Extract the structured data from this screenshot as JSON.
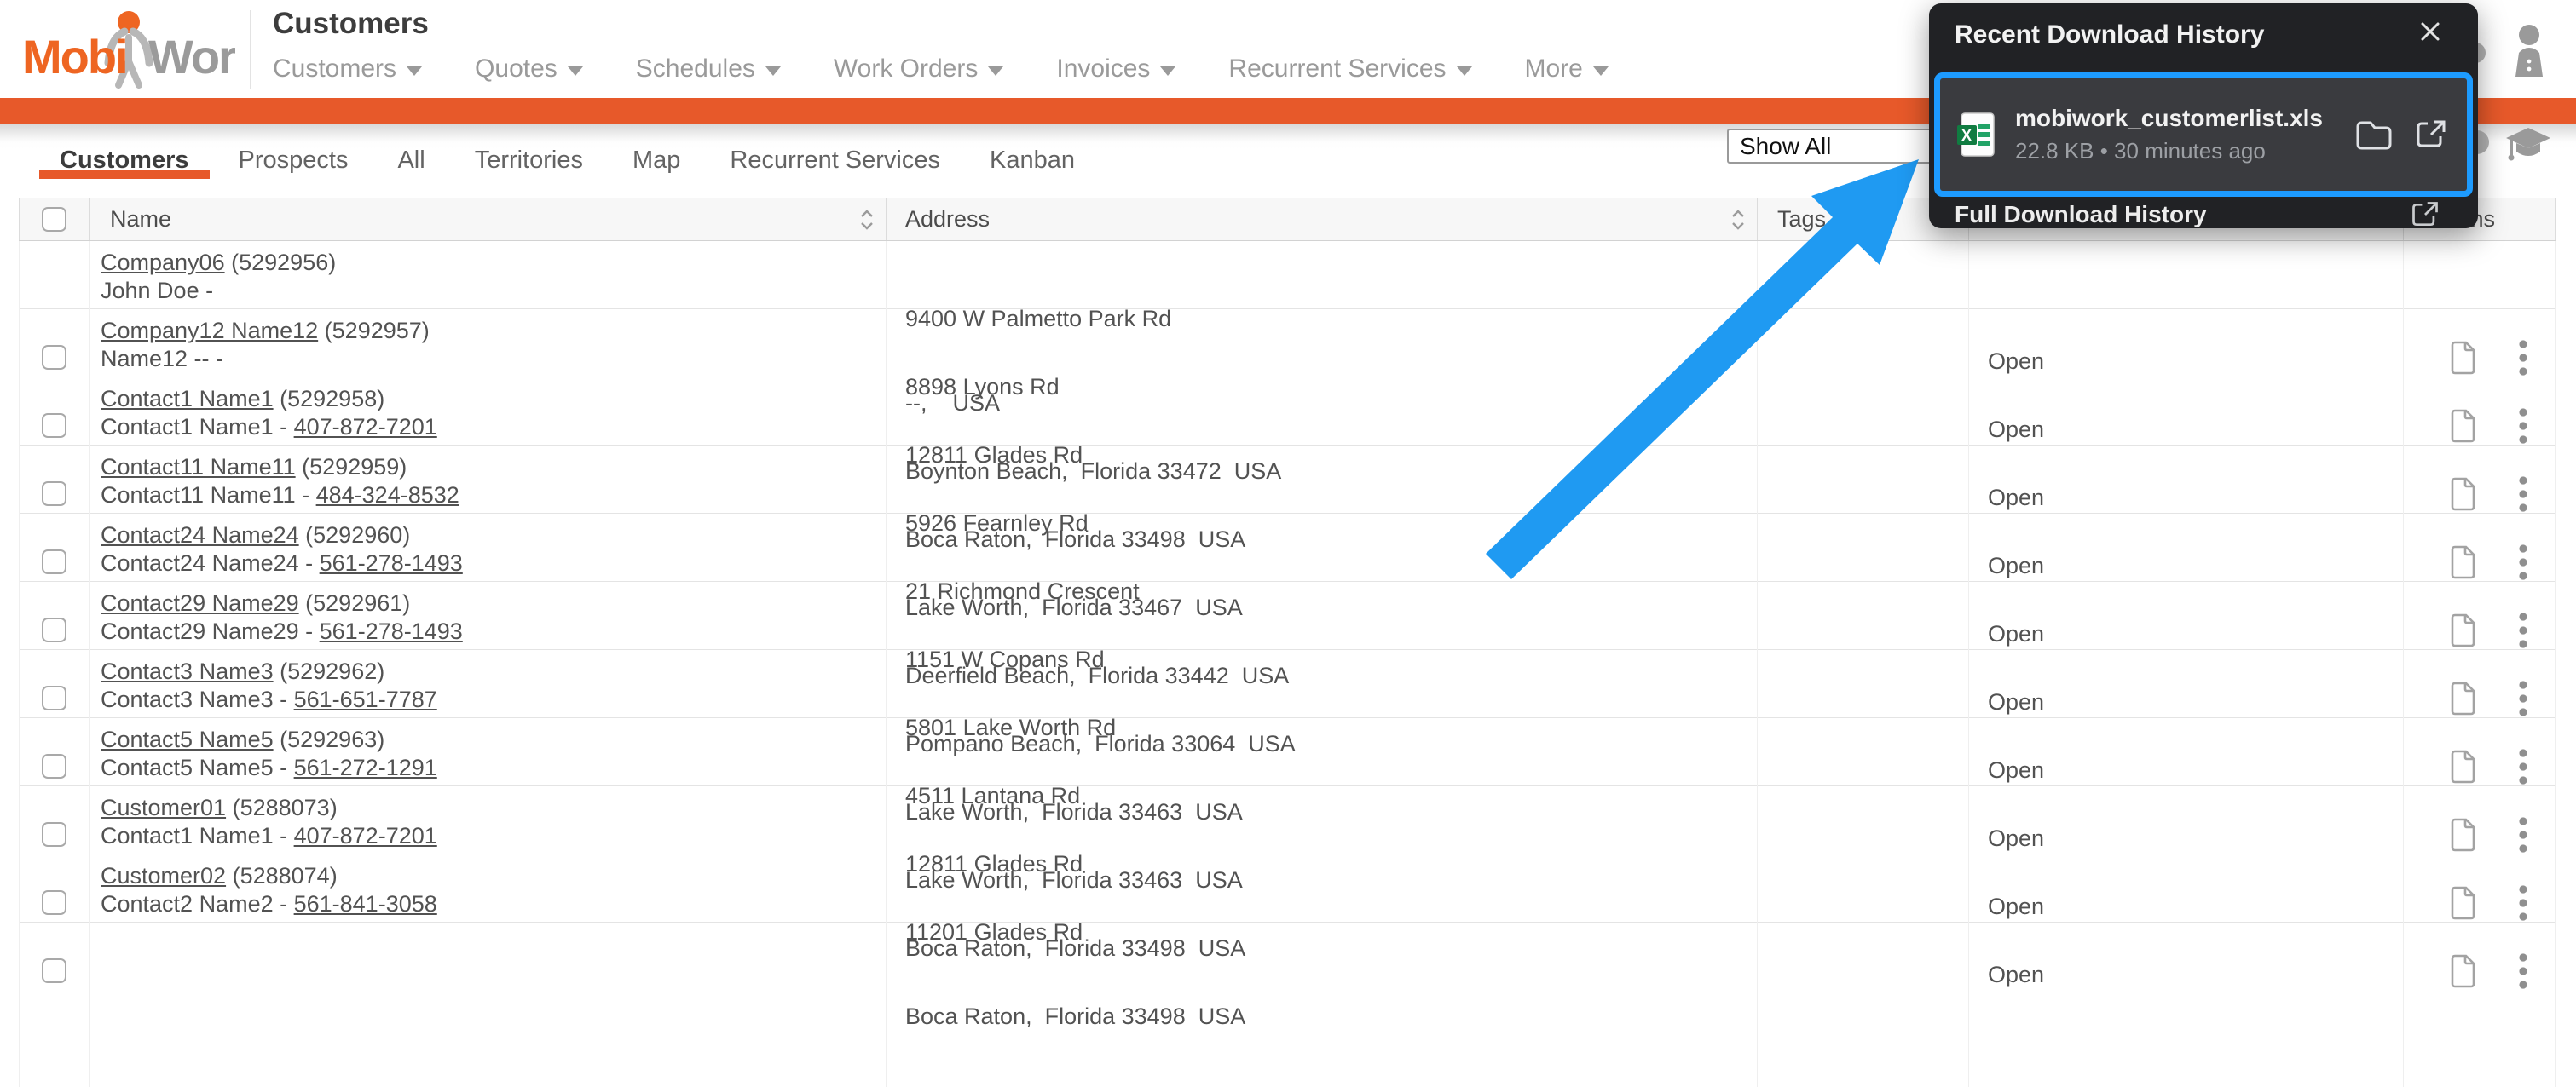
{
  "page_title": "Customers",
  "logo": {
    "part1": "Mobi",
    "part2": "Work"
  },
  "nav": {
    "items": [
      {
        "label": "Customers"
      },
      {
        "label": "Quotes"
      },
      {
        "label": "Schedules"
      },
      {
        "label": "Work Orders"
      },
      {
        "label": "Invoices"
      },
      {
        "label": "Recurrent Services"
      },
      {
        "label": "More"
      }
    ]
  },
  "tabs": [
    {
      "label": "Customers",
      "active": true
    },
    {
      "label": "Prospects"
    },
    {
      "label": "All"
    },
    {
      "label": "Territories"
    },
    {
      "label": "Map"
    },
    {
      "label": "Recurrent Services"
    },
    {
      "label": "Kanban"
    }
  ],
  "filter": {
    "selected": "Show All"
  },
  "download_popup": {
    "title": "Recent Download History",
    "item": {
      "filename": "mobiwork_customerlist.xls",
      "meta": "22.8 KB • 30 minutes ago"
    },
    "footer": "Full Download History"
  },
  "table": {
    "headers": {
      "name": "Name",
      "address": "Address",
      "tags": "Tags",
      "actions": "Actions"
    },
    "open_label": "Open",
    "rows": [
      {
        "link": "Company06",
        "id": "(5292956)",
        "contact": "John Doe -",
        "phone": "",
        "addr1": "9400 W Palmetto Park Rd",
        "addr2": "--,    USA",
        "tags": "",
        "open": "Open"
      },
      {
        "link": "Company12 Name12",
        "id": "(5292957)",
        "contact": "Name12 -- -",
        "phone": "",
        "addr1": "8898 Lyons Rd",
        "addr2": "Boynton Beach,  Florida 33472  USA",
        "tags": "",
        "open": "Open"
      },
      {
        "link": "Contact1 Name1",
        "id": "(5292958)",
        "contact": "Contact1 Name1 - ",
        "phone": "407-872-7201",
        "addr1": "12811 Glades Rd",
        "addr2": "Boca Raton,  Florida 33498  USA",
        "tags": "",
        "open": "Open"
      },
      {
        "link": "Contact11 Name11",
        "id": "(5292959)",
        "contact": "Contact11 Name11 - ",
        "phone": "484-324-8532",
        "addr1": "5926 Fearnley Rd",
        "addr2": "Lake Worth,  Florida 33467  USA",
        "tags": "",
        "open": "Open"
      },
      {
        "link": "Contact24 Name24",
        "id": "(5292960)",
        "contact": "Contact24 Name24 - ",
        "phone": "561-278-1493",
        "addr1": "21 Richmond Crescent",
        "addr2": "Deerfield Beach,  Florida 33442  USA",
        "tags": "",
        "open": "Open"
      },
      {
        "link": "Contact29 Name29",
        "id": "(5292961)",
        "contact": "Contact29 Name29 - ",
        "phone": "561-278-1493",
        "addr1": "1151 W Copans Rd",
        "addr2": "Pompano Beach,  Florida 33064  USA",
        "tags": "",
        "open": "Open"
      },
      {
        "link": "Contact3 Name3",
        "id": "(5292962)",
        "contact": "Contact3 Name3 - ",
        "phone": "561-651-7787",
        "addr1": "5801 Lake Worth Rd",
        "addr2": "Lake Worth,  Florida 33463  USA",
        "tags": "",
        "open": "Open"
      },
      {
        "link": "Contact5 Name5",
        "id": "(5292963)",
        "contact": "Contact5 Name5 - ",
        "phone": "561-272-1291",
        "addr1": "4511 Lantana Rd",
        "addr2": "Lake Worth,  Florida 33463  USA",
        "tags": "",
        "open": "Open"
      },
      {
        "link": "Customer01",
        "id": "(5288073)",
        "contact": "Contact1 Name1 - ",
        "phone": "407-872-7201",
        "addr1": "12811 Glades Rd",
        "addr2": "Boca Raton,  Florida 33498  USA",
        "tags": "",
        "open": "Open"
      },
      {
        "link": "Customer02",
        "id": "(5288074)",
        "contact": "Contact2 Name2 - ",
        "phone": "561-841-3058",
        "addr1": "11201 Glades Rd",
        "addr2": "Boca Raton,  Florida 33498  USA",
        "tags": "",
        "open": "Open"
      }
    ]
  },
  "colors": {
    "brand_orange": "#e7592a",
    "logo_orange": "#ee6522",
    "logo_gray": "#9b9b9b",
    "arrow_blue": "#1f9af2",
    "highlight_blue": "#1d9bff",
    "popup_bg": "#212225",
    "excel_green": "#107c41"
  }
}
